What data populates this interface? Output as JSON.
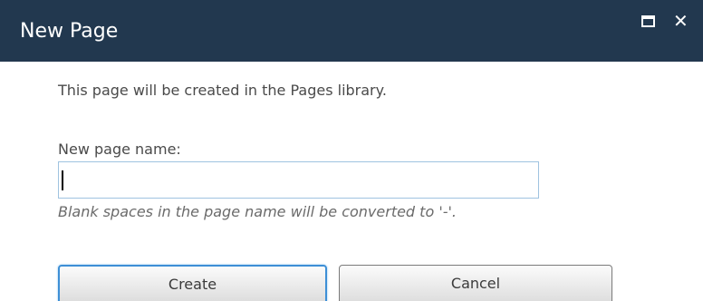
{
  "dialog": {
    "title": "New Page",
    "intro_text": "This page will be created in the Pages library.",
    "name_label": "New page name:",
    "name_value": "",
    "hint_text": "Blank spaces in the page name will be converted to '-'.",
    "create_label": "Create",
    "cancel_label": "Cancel",
    "close_glyph": "✕"
  },
  "icons": {
    "maximize": "maximize-icon",
    "close": "close-icon"
  },
  "colors": {
    "titlebar": "#22384f",
    "input_border": "#9fc3e0",
    "focus_border": "#3d8fd6"
  }
}
